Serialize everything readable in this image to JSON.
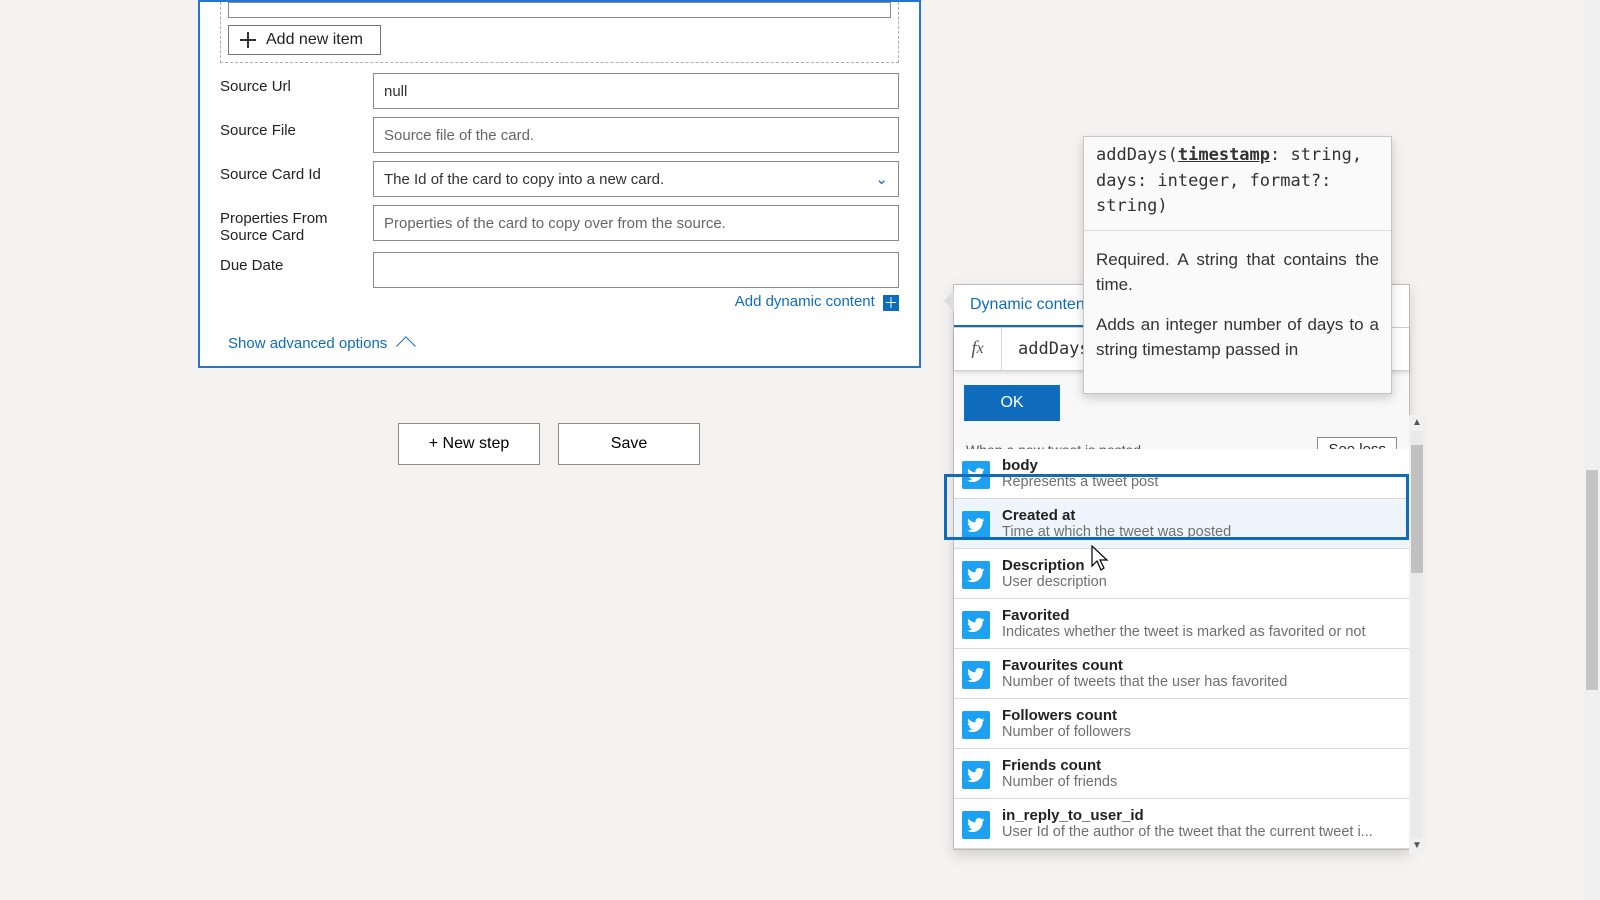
{
  "form": {
    "addItemLabel": "Add new item",
    "fields": {
      "sourceUrl": {
        "label": "Source Url",
        "value": "null"
      },
      "sourceFile": {
        "label": "Source File",
        "placeholder": "Source file of the card."
      },
      "sourceCardId": {
        "label": "Source Card Id",
        "placeholder": "The Id of the card to copy into a new card."
      },
      "propsFromSource": {
        "label": "Properties From Source Card",
        "placeholder": "Properties of the card to copy over from the source."
      },
      "dueDate": {
        "label": "Due Date",
        "value": ""
      }
    },
    "addDynamicContent": "Add dynamic content",
    "showAdvanced": "Show advanced options"
  },
  "buttons": {
    "newStep": "+ New step",
    "save": "Save"
  },
  "dynPanel": {
    "tabs": {
      "dynamic": "Dynamic content"
    },
    "expr": "addDays(",
    "ok": "OK",
    "sectionTitle": "When a new tweet is posted",
    "seeLess": "See less",
    "items": [
      {
        "title": "body",
        "desc": "Represents a tweet post"
      },
      {
        "title": "Created at",
        "desc": "Time at which the tweet was posted"
      },
      {
        "title": "Description",
        "desc": "User description"
      },
      {
        "title": "Favorited",
        "desc": "Indicates whether the tweet is marked as favorited or not"
      },
      {
        "title": "Favourites count",
        "desc": "Number of tweets that the user has favorited"
      },
      {
        "title": "Followers count",
        "desc": "Number of followers"
      },
      {
        "title": "Friends count",
        "desc": "Number of friends"
      },
      {
        "title": "in_reply_to_user_id",
        "desc": "User Id of the author of the tweet that the current tweet i..."
      }
    ]
  },
  "tooltip": {
    "sig_pre": "addDays(",
    "sig_arg": "timestamp",
    "sig_rest": ": string, days: integer, format?: string)",
    "p1": "Required. A string that contains the time.",
    "p2": "Adds an integer number of days to a string timestamp passed in"
  }
}
